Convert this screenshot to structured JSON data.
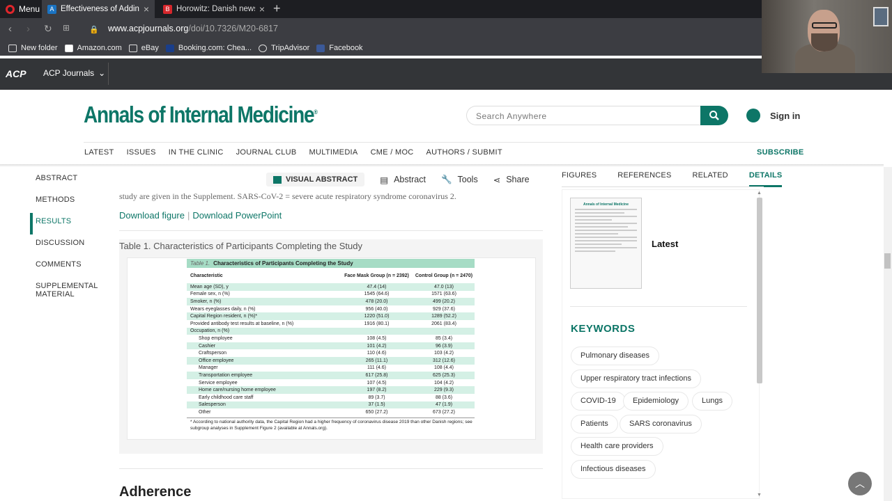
{
  "browser": {
    "menu_label": "Menu",
    "tabs": [
      {
        "title": "Effectiveness of Adding a M",
        "favicon_color": "#1a73c2"
      },
      {
        "title": "Horowitz: Danish newspap",
        "favicon_color": "#d6272c"
      }
    ],
    "url_host": "www.acpjournals.org",
    "url_path": "/doi/10.7326/M20-6817",
    "bookmarks": [
      "New folder",
      "Amazon.com",
      "eBay",
      "Booking.com: Chea...",
      "TripAdvisor",
      "Facebook"
    ]
  },
  "acp": {
    "logo": "ACP",
    "journals_label": "ACP Journals"
  },
  "header": {
    "journal_title": "Annals of Internal Medicine",
    "registered": "®",
    "search_placeholder": "Search Anywhere",
    "signin": "Sign in",
    "nav": [
      "LATEST",
      "ISSUES",
      "IN THE CLINIC",
      "JOURNAL CLUB",
      "MULTIMEDIA",
      "CME / MOC",
      "AUTHORS / SUBMIT"
    ],
    "subscribe": "SUBSCRIBE",
    "accent_color": "#0d7667"
  },
  "sidenav": [
    "ABSTRACT",
    "METHODS",
    "RESULTS",
    "DISCUSSION",
    "COMMENTS",
    "SUPPLEMENTAL MATERIAL"
  ],
  "sidenav_active": "RESULTS",
  "toolbar": {
    "visual_abstract": "VISUAL ABSTRACT",
    "abstract": "Abstract",
    "tools": "Tools",
    "share": "Share"
  },
  "article": {
    "cut_text": "study are given in the Supplement. SARS-CoV-2 = severe acute respiratory syndrome coronavirus 2.",
    "download_figure": "Download figure",
    "download_ppt": "Download PowerPoint",
    "table_caption": "Table 1. Characteristics of Participants Completing the Study",
    "next_heading": "Adherence"
  },
  "table": {
    "label": "Table 1.",
    "title": "Characteristics of Participants Completing the Study",
    "col_characteristic": "Characteristic",
    "col_mask": "Face Mask Group (n = 2392)",
    "col_control": "Control Group (n = 2470)",
    "rows": [
      {
        "label": "Mean age (SD), y",
        "mask": "47.4 (14)",
        "control": "47.0 (13)",
        "indent": false
      },
      {
        "label": "Female sex, n (%)",
        "mask": "1545 (64.6)",
        "control": "1571 (63.6)",
        "indent": false
      },
      {
        "label": "Smoker, n (%)",
        "mask": "478 (20.0)",
        "control": "499 (20.2)",
        "indent": false
      },
      {
        "label": "Wears eyeglasses daily, n (%)",
        "mask": "956 (40.0)",
        "control": "929 (37.6)",
        "indent": false
      },
      {
        "label": "Capital Region resident, n (%)*",
        "mask": "1220 (51.0)",
        "control": "1289 (52.2)",
        "indent": false
      },
      {
        "label": "Provided antibody test results at baseline, n (%)",
        "mask": "1916 (80.1)",
        "control": "2061 (83.4)",
        "indent": false
      },
      {
        "label": "Occupation, n (%)",
        "mask": "",
        "control": "",
        "indent": false
      },
      {
        "label": "Shop employee",
        "mask": "108 (4.5)",
        "control": "85 (3.4)",
        "indent": true
      },
      {
        "label": "Cashier",
        "mask": "101 (4.2)",
        "control": "96 (3.9)",
        "indent": true
      },
      {
        "label": "Craftsperson",
        "mask": "110 (4.6)",
        "control": "103 (4.2)",
        "indent": true
      },
      {
        "label": "Office employee",
        "mask": "265 (11.1)",
        "control": "312 (12.6)",
        "indent": true
      },
      {
        "label": "Manager",
        "mask": "111 (4.6)",
        "control": "108 (4.4)",
        "indent": true
      },
      {
        "label": "Transportation employee",
        "mask": "617 (25.8)",
        "control": "625 (25.3)",
        "indent": true
      },
      {
        "label": "Service employee",
        "mask": "107 (4.5)",
        "control": "104 (4.2)",
        "indent": true
      },
      {
        "label": "Home care/nursing home employee",
        "mask": "197 (8.2)",
        "control": "229 (9.3)",
        "indent": true
      },
      {
        "label": "Early childhood care staff",
        "mask": "89 (3.7)",
        "control": "88 (3.6)",
        "indent": true
      },
      {
        "label": "Salesperson",
        "mask": "37 (1.5)",
        "control": "47 (1.9)",
        "indent": true
      },
      {
        "label": "Other",
        "mask": "650 (27.2)",
        "control": "673 (27.2)",
        "indent": true
      }
    ],
    "footnote": "* According to national authority data, the Capital Region had a higher frequency of coronavirus disease 2019 than other Danish regions; see subgroup analyses in Supplement Figure 2 (available at Annals.org)."
  },
  "right_panel": {
    "tabs": [
      "FIGURES",
      "REFERENCES",
      "RELATED",
      "DETAILS"
    ],
    "active_tab": "DETAILS",
    "thumb_title": "Annals of Internal Medicine",
    "latest": "Latest",
    "keywords_title": "KEYWORDS",
    "keywords": [
      "Pulmonary diseases",
      "Upper respiratory tract infections",
      "COVID-19",
      "Epidemiology",
      "Lungs",
      "Patients",
      "SARS coronavirus",
      "Health care providers",
      "Infectious diseases"
    ]
  }
}
